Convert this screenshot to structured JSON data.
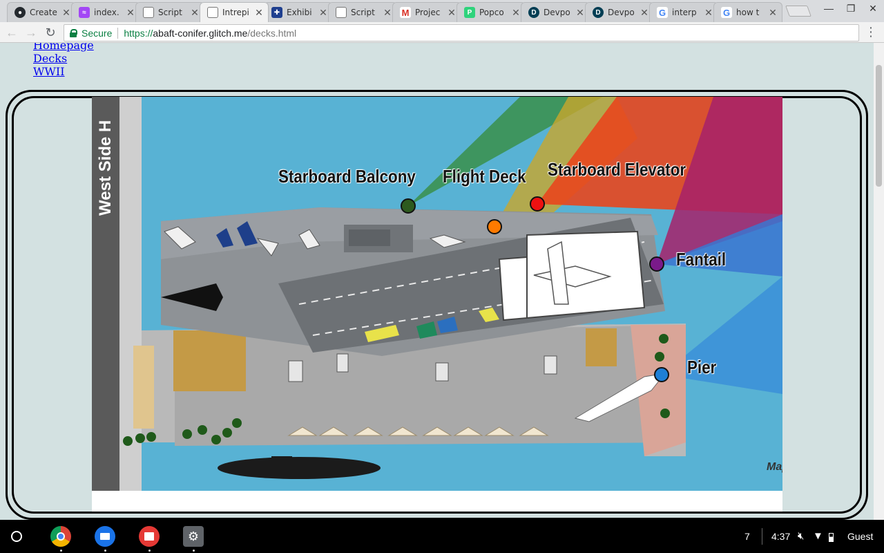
{
  "browser": {
    "tabs": [
      {
        "title": "Create",
        "icon": "github-icon",
        "color": "#24292e"
      },
      {
        "title": "index.",
        "icon": "glitch-icon",
        "color": "#a347f5"
      },
      {
        "title": "Script",
        "icon": "document-icon",
        "color": "#777777"
      },
      {
        "title": "Intrepi",
        "icon": "document-icon",
        "color": "#777777",
        "active": true
      },
      {
        "title": "Exhibi",
        "icon": "exhibit-icon",
        "color": "#1f3f8f"
      },
      {
        "title": "Script",
        "icon": "document-icon",
        "color": "#777777"
      },
      {
        "title": "Projec",
        "icon": "gmail-icon",
        "color": "#d93025"
      },
      {
        "title": "Popco",
        "icon": "popcorn-icon",
        "color": "#2fd37c"
      },
      {
        "title": "Devpo",
        "icon": "devpost-icon",
        "color": "#003e54"
      },
      {
        "title": "Devpo",
        "icon": "devpost-icon",
        "color": "#003e54"
      },
      {
        "title": "interp",
        "icon": "google-icon",
        "color": "#4285f4"
      },
      {
        "title": "how t",
        "icon": "google-icon",
        "color": "#4285f4"
      }
    ],
    "secure_label": "Secure",
    "url": {
      "protocol": "https://",
      "host": "abaft-conifer.glitch.me",
      "path": "/decks.html"
    }
  },
  "page": {
    "nav_links": [
      "Homepage",
      "Decks",
      "WWII"
    ],
    "map": {
      "road_label": "West Side H",
      "credit": "Map",
      "locations": [
        {
          "name": "Starboard Balcony",
          "color": "#2d5a1e"
        },
        {
          "name": "Flight Deck",
          "color": "#ff7a00"
        },
        {
          "name": "Starboard Elevator",
          "color": "#ee1111"
        },
        {
          "name": "Fantail",
          "color": "#7a1a8a"
        },
        {
          "name": "Pier",
          "color": "#1e7fd6"
        }
      ]
    }
  },
  "shelf": {
    "apps": [
      "chrome-icon",
      "files-icon",
      "gallery-icon",
      "settings-icon"
    ],
    "notification_count": "7",
    "time": "4:37",
    "user": "Guest"
  }
}
